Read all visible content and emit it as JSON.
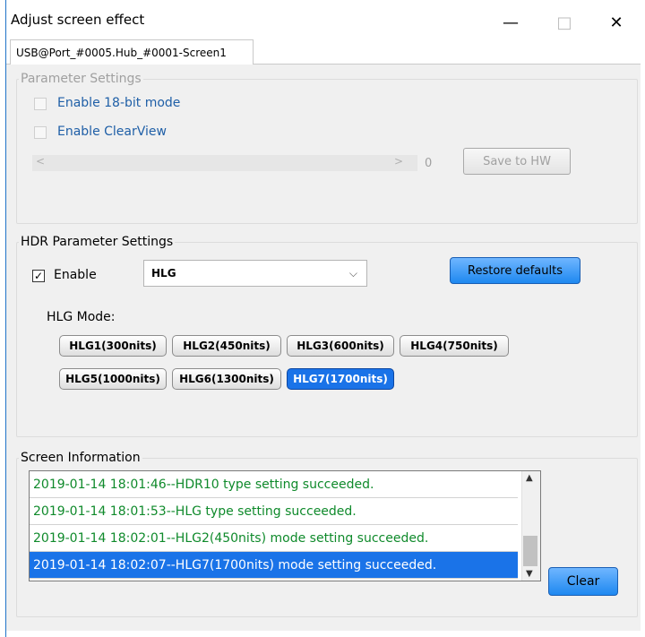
{
  "window": {
    "title": "Adjust screen effect",
    "controls": {
      "minimize": "—",
      "maximize": "□",
      "close": "✕"
    }
  },
  "tab": {
    "label": "USB@Port_#0005.Hub_#0001-Screen1"
  },
  "parameter_settings": {
    "legend": "Parameter Settings",
    "enable_18bit_label": "Enable 18-bit mode",
    "enable_clearview_label": "Enable ClearView",
    "slider_value": "0",
    "save_button": "Save to HW"
  },
  "hdr_settings": {
    "legend": "HDR Parameter Settings",
    "enable_label": "Enable",
    "enable_checked": true,
    "type_select": "HLG",
    "restore_button": "Restore defaults",
    "mode_label": "HLG Mode:",
    "modes": [
      "HLG1(300nits)",
      "HLG2(450nits)",
      "HLG3(600nits)",
      "HLG4(750nits)",
      "HLG5(1000nits)",
      "HLG6(1300nits)",
      "HLG7(1700nits)"
    ],
    "selected_mode": "HLG7(1700nits)"
  },
  "screen_info": {
    "legend": "Screen Information",
    "log": [
      "2019-01-14 18:01:46--HDR10 type setting succeeded.",
      "2019-01-14 18:01:53--HLG type setting succeeded.",
      "2019-01-14 18:02:01--HLG2(450nits) mode setting succeeded.",
      "2019-01-14 18:02:07--HLG7(1700nits) mode setting succeeded."
    ],
    "clear_button": "Clear"
  },
  "colors": {
    "accent": "#1a73e8",
    "log_text": "#0f8a2b"
  }
}
